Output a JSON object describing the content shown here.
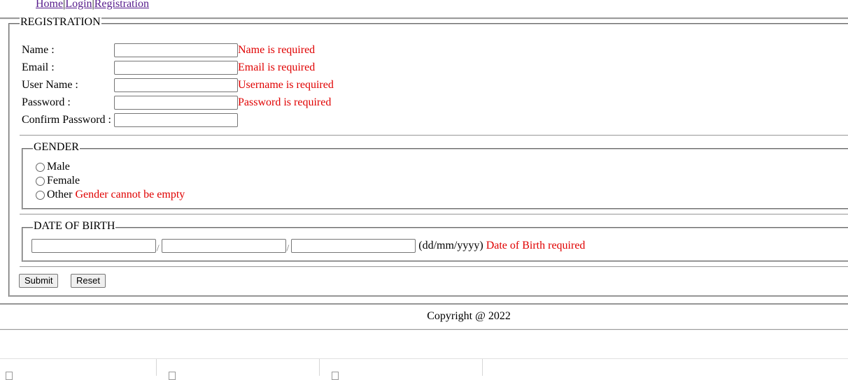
{
  "nav": {
    "home": "Home",
    "login": "Login",
    "registration": "Registration",
    "separator": "|"
  },
  "registration": {
    "legend": "REGISTRATION",
    "fields": [
      {
        "label": "Name :",
        "value": "",
        "error": "Name is required"
      },
      {
        "label": "Email :",
        "value": "",
        "error": "Email is required"
      },
      {
        "label": "User Name :",
        "value": "",
        "error": "Username is required"
      },
      {
        "label": "Password :",
        "value": "",
        "error": "Password is required"
      },
      {
        "label": "Confirm Password :",
        "value": "",
        "error": ""
      }
    ],
    "gender": {
      "legend": "GENDER",
      "options": [
        "Male",
        "Female",
        "Other"
      ],
      "error": "Gender cannot be empty"
    },
    "dob": {
      "legend": "DATE OF BIRTH",
      "separator": "/",
      "format_hint": "(dd/mm/yyyy)",
      "error": "Date of Birth required"
    },
    "buttons": {
      "submit": "Submit",
      "reset": "Reset"
    }
  },
  "footer": {
    "copyright": "Copyright @ 2022"
  },
  "colors": {
    "error": "#e00000",
    "link": "#0000ee",
    "visited_link": "#551a8b"
  }
}
